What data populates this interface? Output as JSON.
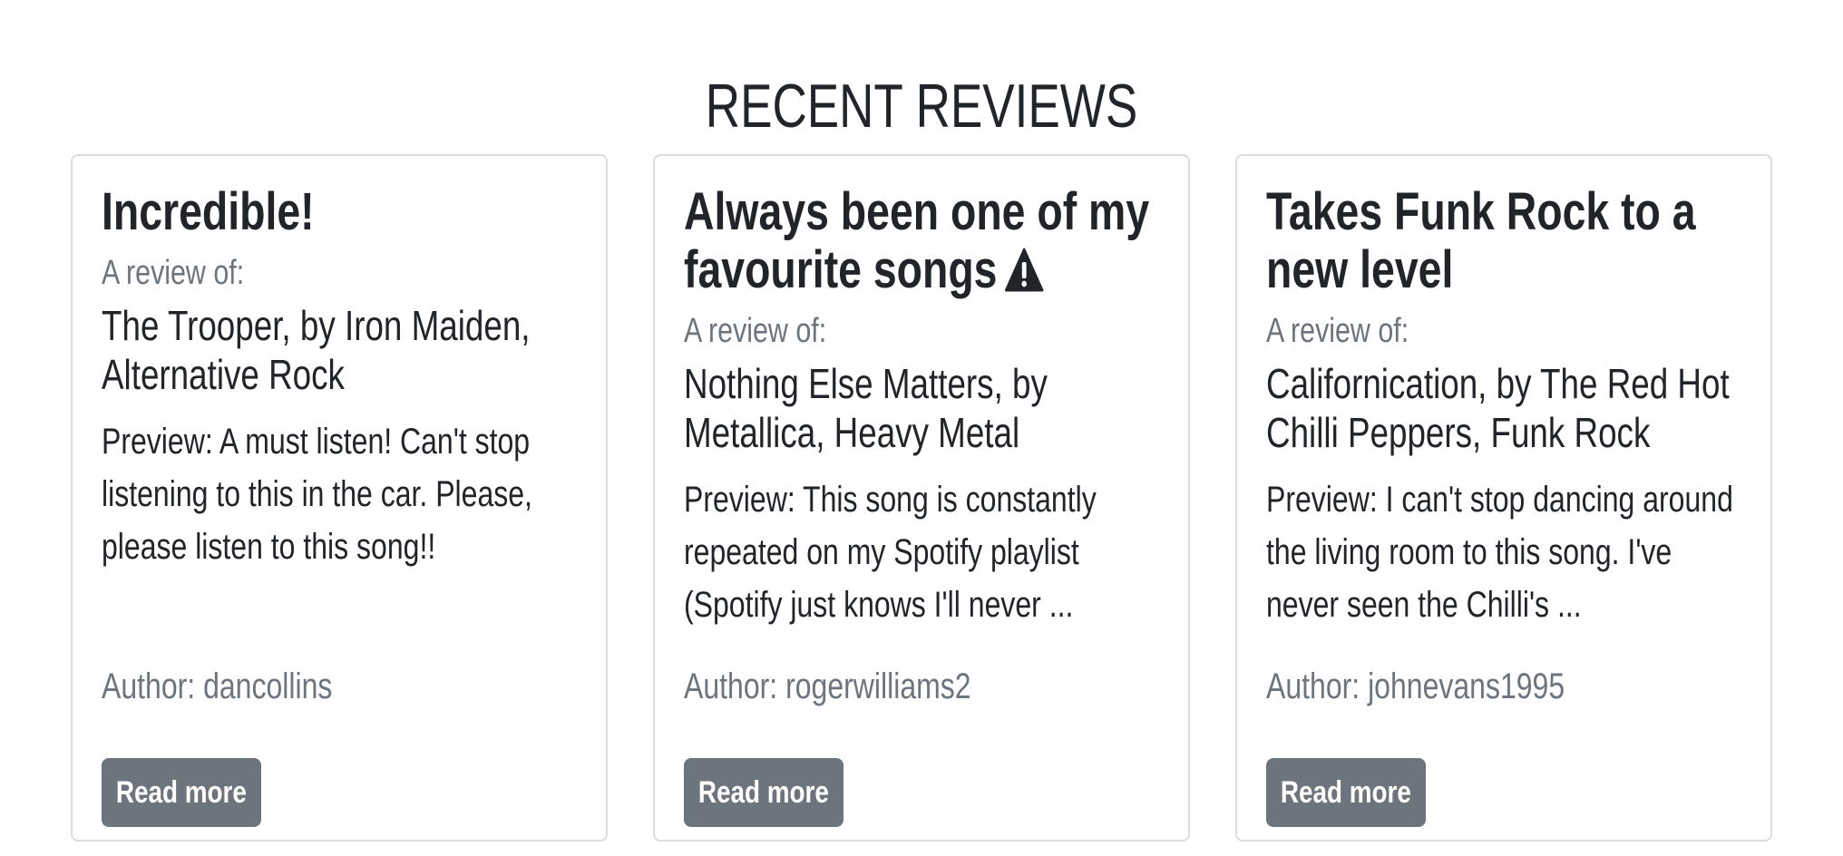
{
  "section": {
    "title": "RECENT REVIEWS"
  },
  "reviews": [
    {
      "title": "Incredible!",
      "warning": false,
      "subtitle": "A review of:",
      "song": "The Trooper, by Iron Maiden, Alternative Rock",
      "preview": "Preview: A must listen! Can't stop listening to this in the car. Please, please listen to this song!!",
      "author": "Author: dancollins",
      "button_label": "Read more"
    },
    {
      "title": "Always been one of my favourite songs",
      "warning": true,
      "warning_icon": "warning-triangle-icon",
      "subtitle": "A review of:",
      "song": "Nothing Else Matters, by Metallica, Heavy Metal",
      "preview": "Preview: This song is constantly repeated on my Spotify playlist (Spotify just knows I'll never ...",
      "author": "Author: rogerwilliams2",
      "button_label": "Read more"
    },
    {
      "title": "Takes Funk Rock to a new level",
      "warning": false,
      "subtitle": "A review of:",
      "song": "Californication, by The Red Hot Chilli Peppers, Funk Rock",
      "preview": "Preview: I can't stop dancing around the living room to this song. I've never seen the Chilli's ...",
      "author": "Author: johnevans1995",
      "button_label": "Read more"
    }
  ],
  "colors": {
    "text": "#212529",
    "muted": "#6c757d",
    "button": "#6c757d",
    "border": "#dcdcdc"
  }
}
